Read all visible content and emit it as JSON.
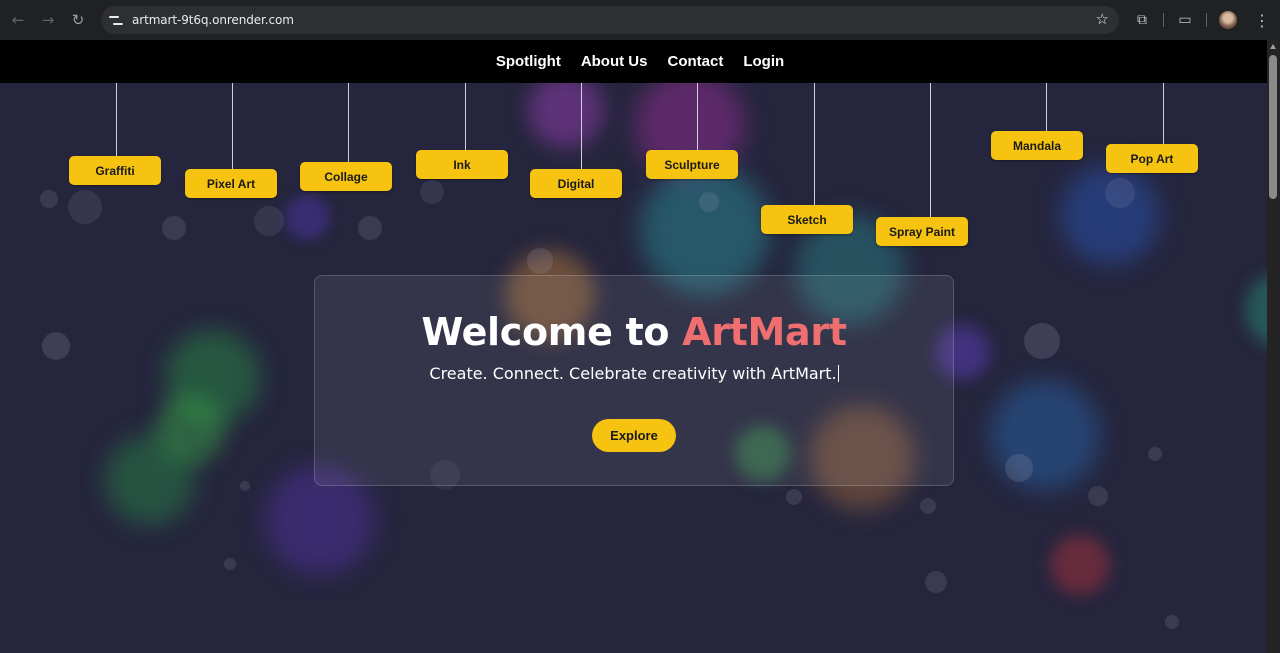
{
  "browser": {
    "url": "artmart-9t6q.onrender.com",
    "back_icon": "arrow-left",
    "forward_icon": "arrow-right",
    "reload_icon": "reload",
    "bookmark_icon": "star",
    "extensions_icon": "puzzle",
    "sidepanel_icon": "side-panel",
    "menu_icon": "kebab-vertical"
  },
  "nav": {
    "items": [
      "Spotlight",
      "About Us",
      "Contact",
      "Login"
    ]
  },
  "tags": [
    "Graffiti",
    "Pixel Art",
    "Collage",
    "Ink",
    "Digital",
    "Sculpture",
    "Sketch",
    "Spray Paint",
    "Mandala",
    "Pop Art"
  ],
  "hero": {
    "title_prefix": "Welcome to ",
    "title_brand": "ArtMart",
    "subtitle": "Create. Connect. Celebrate creativity with ArtMart.",
    "cta": "Explore"
  },
  "colors": {
    "accent": "#f6c310",
    "brand": "#ef6f70",
    "background": "#25253d",
    "navbar": "#000000"
  }
}
